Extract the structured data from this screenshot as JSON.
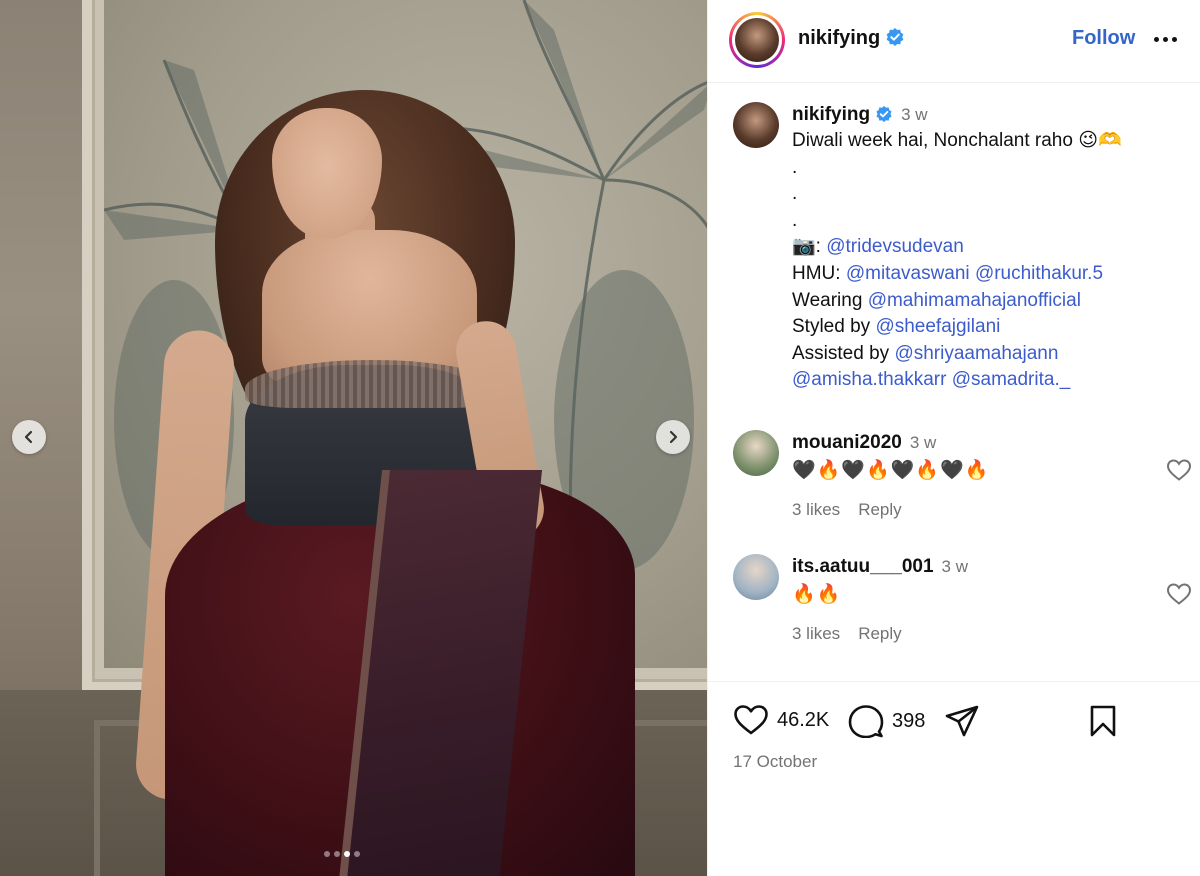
{
  "post": {
    "username": "nikifying",
    "follow_label": "Follow",
    "carousel": {
      "total": 4,
      "active": 2
    }
  },
  "caption": {
    "username": "nikifying",
    "time": "3 w",
    "first_line": "Diwali week hai, Nonchalant raho 😉🫶",
    "dots": [
      ".",
      ".",
      "."
    ],
    "camera_emoji": "📷",
    "credits": {
      "photographer": "@tridevsudevan",
      "hmu_label": "HMU: ",
      "hmu": [
        "@mitavaswani",
        "@ruchithakur.5"
      ],
      "wearing_label": "Wearing ",
      "wearing": "@mahimamahajanofficial",
      "styled_label": "Styled by ",
      "styled": "@sheefajgilani",
      "assisted_label": "Assisted by ",
      "assisted": [
        "@shriyaamahajann",
        "@amisha.thakkarr",
        "@samadrita._"
      ]
    }
  },
  "comments": [
    {
      "username": "mouani2020",
      "time": "3 w",
      "text": "🖤🔥🖤🔥🖤🔥🖤🔥",
      "likes": "3 likes",
      "reply": "Reply",
      "avatar_color": "#7a8f6a"
    },
    {
      "username": "its.aatuu___001",
      "time": "3 w",
      "text": "🔥🔥",
      "likes": "3 likes",
      "reply": "Reply",
      "avatar_color": "#9fb3c4"
    }
  ],
  "actions": {
    "likes_count": "46.2K",
    "comments_count": "398",
    "date": "17 October"
  },
  "colors": {
    "link": "#3d5ccc",
    "follow": "#3465c9",
    "muted": "#737373",
    "verified": "#3897f0"
  },
  "icons": {
    "prev": "chevron-left-icon",
    "next": "chevron-right-icon",
    "verified": "verified-badge-icon",
    "more": "more-horizontal-icon",
    "like": "heart-icon",
    "comment": "comment-icon",
    "share": "paper-plane-icon",
    "save": "bookmark-icon"
  }
}
